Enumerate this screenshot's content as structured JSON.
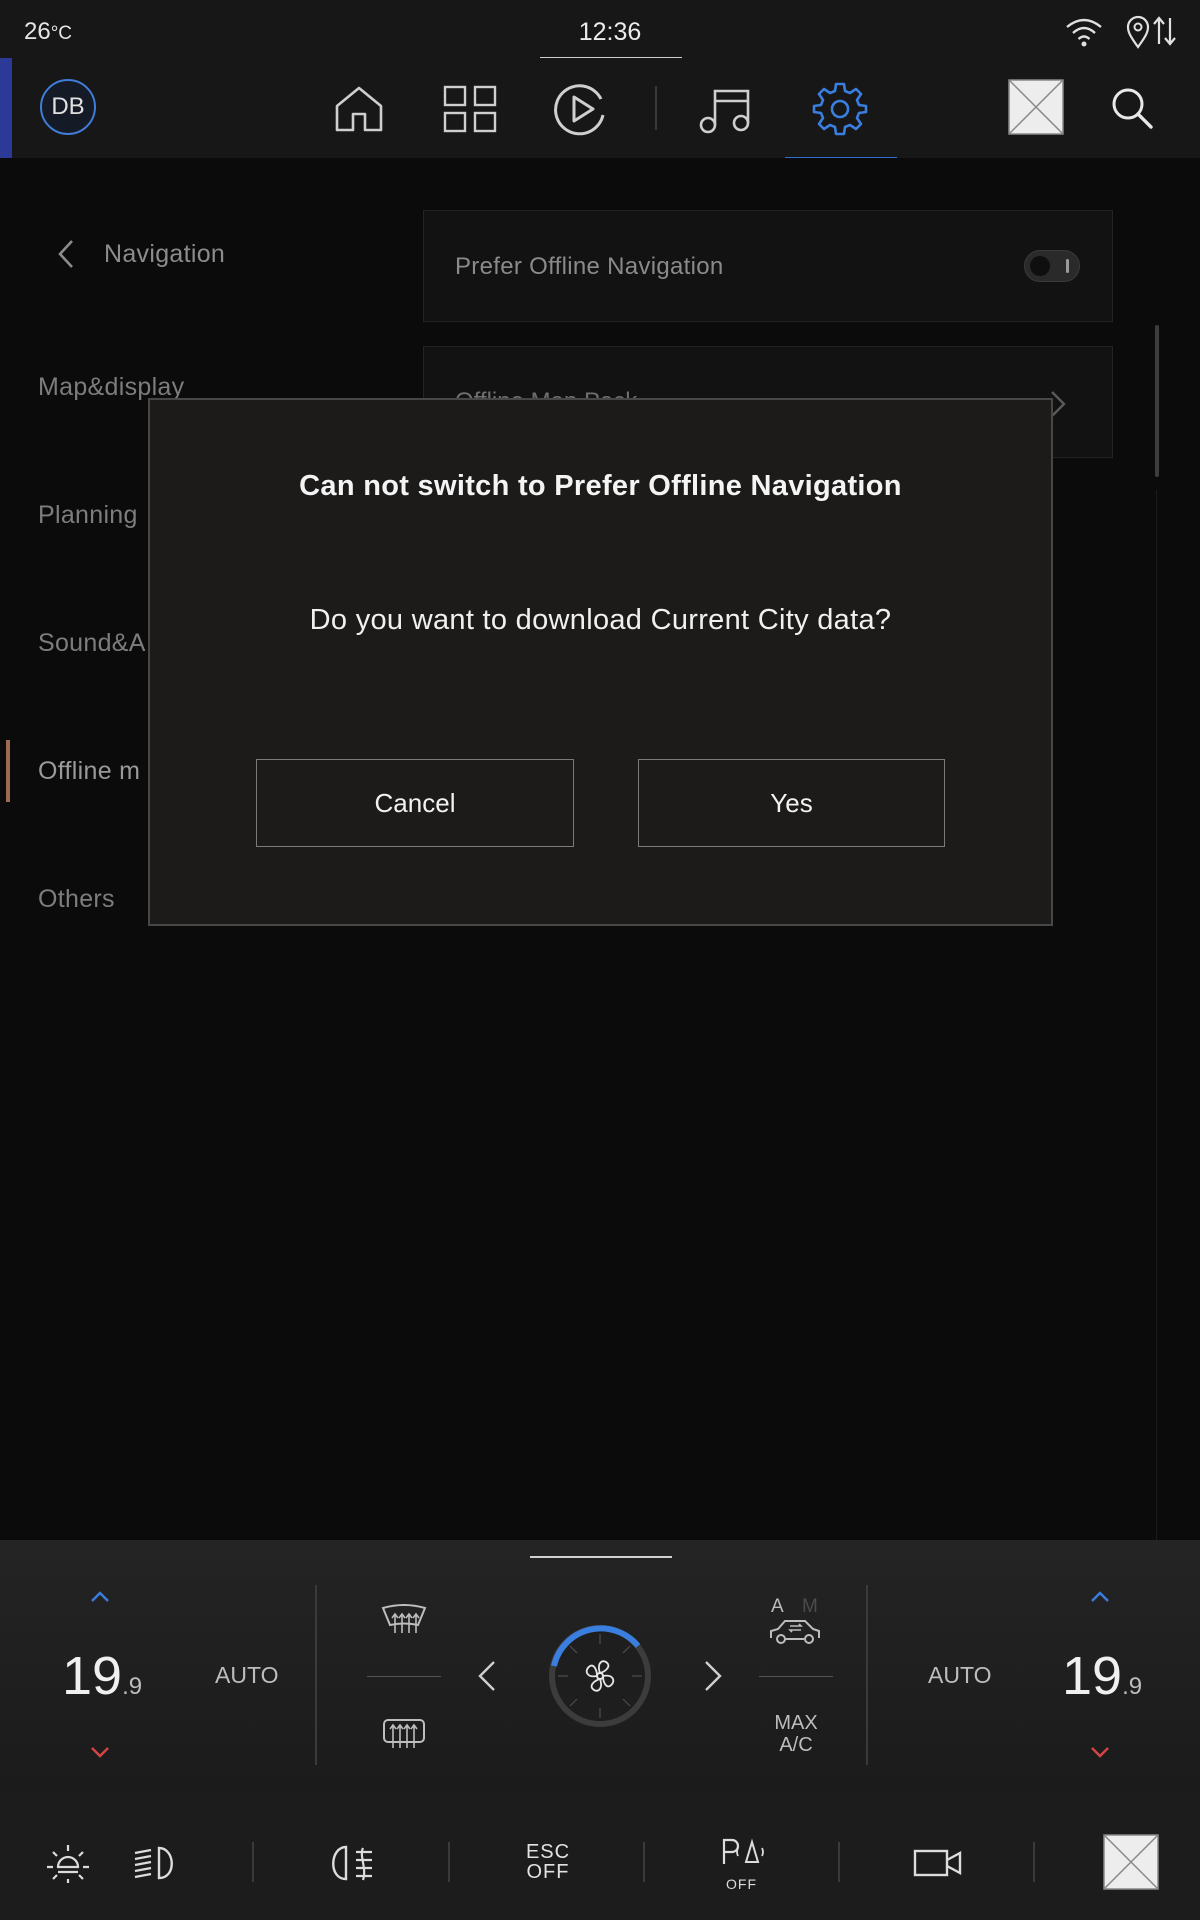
{
  "status_bar": {
    "temperature": "26",
    "temperature_unit": "°C",
    "time": "12:36"
  },
  "top_nav": {
    "avatar_initials": "DB",
    "items": [
      "home-icon",
      "apps-grid-icon",
      "play-icon",
      "music-icon",
      "gear-icon"
    ],
    "active_item": "gear-icon",
    "accent_color": "#3a7ee0"
  },
  "settings": {
    "back_label": "Navigation",
    "sidebar": [
      "Map&display",
      "Planning",
      "Sound&A",
      "Offline m",
      "Others"
    ],
    "active_sidebar_item": "Offline m",
    "prefer_offline_label": "Prefer Offline Navigation",
    "prefer_offline_enabled": false,
    "offline_map_pack_label": "Offline Map Pack"
  },
  "dialog": {
    "title": "Can not switch to Prefer Offline Navigation",
    "message": "Do you want to download Current City data?",
    "cancel_label": "Cancel",
    "yes_label": "Yes"
  },
  "climate": {
    "left_temp": "19",
    "left_temp_decimal": ".9",
    "left_mode": "AUTO",
    "right_temp": "19",
    "right_temp_decimal": ".9",
    "right_mode": "AUTO",
    "recirc_a": "A",
    "recirc_m": "M",
    "max_ac_line1": "MAX",
    "max_ac_line2": "A/C"
  },
  "bottom_bar": {
    "esc_line1": "ESC",
    "esc_line2": "OFF",
    "park_assist_label": "OFF"
  }
}
